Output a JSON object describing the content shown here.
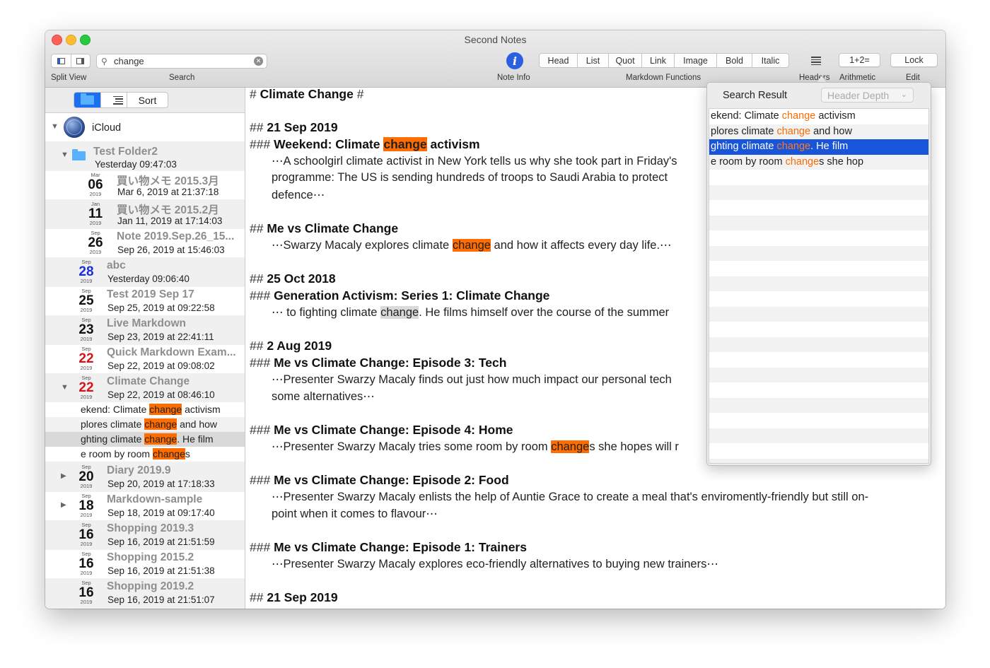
{
  "window": {
    "title": "Second Notes"
  },
  "toolbar": {
    "split_view_label": "Split View",
    "search_label": "Search",
    "search_value": "change",
    "note_info_label": "Note Info",
    "markdown_functions_label": "Markdown Functions",
    "markdown_buttons": [
      "Head",
      "List",
      "Quot",
      "Link",
      "Image",
      "Bold",
      "Italic"
    ],
    "headers_label": "Headers",
    "arithmetic_button": "1+2=",
    "arithmetic_label": "Arithmetic",
    "lock_button": "Lock",
    "edit_label": "Edit"
  },
  "sidebar": {
    "sort_label": "Sort",
    "account": "iCloud",
    "folder": {
      "name": "Test Folder2",
      "date": "Yesterday 09:47:03"
    },
    "notes": [
      {
        "month": "Mar",
        "day": "06",
        "year": "2019",
        "title": "買い物メモ 2015.3月",
        "date": "Mar 6, 2019 at 21:37:18",
        "color": "black"
      },
      {
        "month": "Jan",
        "day": "11",
        "year": "2019",
        "title": "買い物メモ 2015.2月",
        "date": "Jan 11, 2019 at 17:14:03",
        "color": "black"
      },
      {
        "month": "Sep",
        "day": "26",
        "year": "2019",
        "title": "Note 2019.Sep.26_15...",
        "date": "Sep 26, 2019 at 15:46:03",
        "color": "black"
      },
      {
        "month": "Sep",
        "day": "28",
        "year": "2019",
        "title": "abc",
        "date": "Yesterday 09:06:40",
        "color": "blue"
      },
      {
        "month": "Sep",
        "day": "25",
        "year": "2019",
        "title": "Test 2019 Sep 17",
        "date": "Sep 25, 2019 at 09:22:58",
        "color": "black"
      },
      {
        "month": "Sep",
        "day": "23",
        "year": "2019",
        "title": "Live Markdown",
        "date": "Sep 23, 2019 at 22:41:11",
        "color": "black"
      },
      {
        "month": "Sep",
        "day": "22",
        "year": "2019",
        "title": "Quick Markdown Exam...",
        "date": "Sep 22, 2019 at 09:08:02",
        "color": "red"
      },
      {
        "month": "Sep",
        "day": "22",
        "year": "2019",
        "title": "Climate Change",
        "date": "Sep 22, 2019 at 08:46:10",
        "color": "red"
      },
      {
        "month": "Sep",
        "day": "20",
        "year": "2019",
        "title": "Diary 2019.9",
        "date": "Sep 20, 2019 at 17:18:33",
        "color": "black"
      },
      {
        "month": "Sep",
        "day": "18",
        "year": "2019",
        "title": "Markdown-sample",
        "date": "Sep 18, 2019 at 09:17:40",
        "color": "black"
      },
      {
        "month": "Sep",
        "day": "16",
        "year": "2019",
        "title": "Shopping 2019.3",
        "date": "Sep 16, 2019 at 21:51:59",
        "color": "black"
      },
      {
        "month": "Sep",
        "day": "16",
        "year": "2019",
        "title": "Shopping 2015.2",
        "date": "Sep 16, 2019 at 21:51:38",
        "color": "black"
      },
      {
        "month": "Sep",
        "day": "16",
        "year": "2019",
        "title": "Shopping 2019.2",
        "date": "Sep 16, 2019 at 21:51:07",
        "color": "black"
      }
    ],
    "snippets": [
      {
        "pre": "ekend: Climate ",
        "match": "change",
        "post": " activism"
      },
      {
        "pre": "plores climate ",
        "match": "change",
        "post": " and how"
      },
      {
        "pre": "ghting climate ",
        "match": "change",
        "post": ". He film"
      },
      {
        "pre": "e room by room ",
        "match": "change",
        "post": "s"
      }
    ]
  },
  "editor": {
    "title_mark_open": "#",
    "title": "Climate Change",
    "title_mark_close": "#",
    "h2_mark": "##",
    "h3_mark": "###",
    "sections": [
      {
        "h2": "21 Sep 2019"
      },
      {
        "h3_pre": "Weekend: Climate ",
        "h3_match": "change",
        "h3_post": " activism",
        "body1": "⋯A schoolgirl climate activist in New York tells us why she took part in Friday's",
        "body2": "programme: The US is sending hundreds of troops to Saudi Arabia to protect",
        "body3": "defence⋯"
      },
      {
        "h2": "Me vs Climate Change",
        "body_pre": "⋯Swarzy Macaly explores climate ",
        "body_match": "change",
        "body_post": " and how it affects every day life.⋯"
      },
      {
        "h2": "25 Oct 2018"
      },
      {
        "h3": "Generation Activism: Series 1: Climate Change",
        "body_pre": "⋯ to fighting climate ",
        "body_match": "change",
        "body_post": ". He films himself over the course of the summer"
      },
      {
        "h2": "2 Aug 2019"
      },
      {
        "h3": "Me vs Climate Change: Episode 3: Tech",
        "body1": "⋯Presenter Swarzy Macaly finds out just how much impact our personal tech",
        "body2": "some alternatives⋯"
      },
      {
        "h3": "Me vs Climate Change: Episode 4: Home",
        "body_pre": "⋯Presenter Swarzy Macaly tries some room by room ",
        "body_match": "change",
        "body_post": "s she hopes will r"
      },
      {
        "h3": "Me vs Climate Change: Episode 2: Food",
        "body1": "⋯Presenter Swarzy Macaly enlists the help of Auntie Grace to create a meal that's enviromently-friendly but still on-",
        "body2": "point when it comes to flavour⋯"
      },
      {
        "h3": "Me vs Climate Change: Episode 1: Trainers",
        "body1": "⋯Presenter Swarzy Macaly explores eco-friendly alternatives to buying new trainers⋯"
      },
      {
        "h2": "21 Sep 2019"
      }
    ]
  },
  "search_popover": {
    "title": "Search Result",
    "header_depth_placeholder": "Header Depth",
    "results": [
      {
        "pre": "ekend: Climate ",
        "match": "change",
        "post": " activism"
      },
      {
        "pre": "plores climate ",
        "match": "change",
        "post": " and how"
      },
      {
        "pre": "ghting climate ",
        "match": "change",
        "post": ". He film"
      },
      {
        "pre": "e room by room ",
        "match": "change",
        "post": "s she hop"
      }
    ],
    "selected_index": 2
  },
  "colors": {
    "highlight": "#ff6d00",
    "selection": "#1955d8",
    "accent": "#1b6ff0"
  }
}
